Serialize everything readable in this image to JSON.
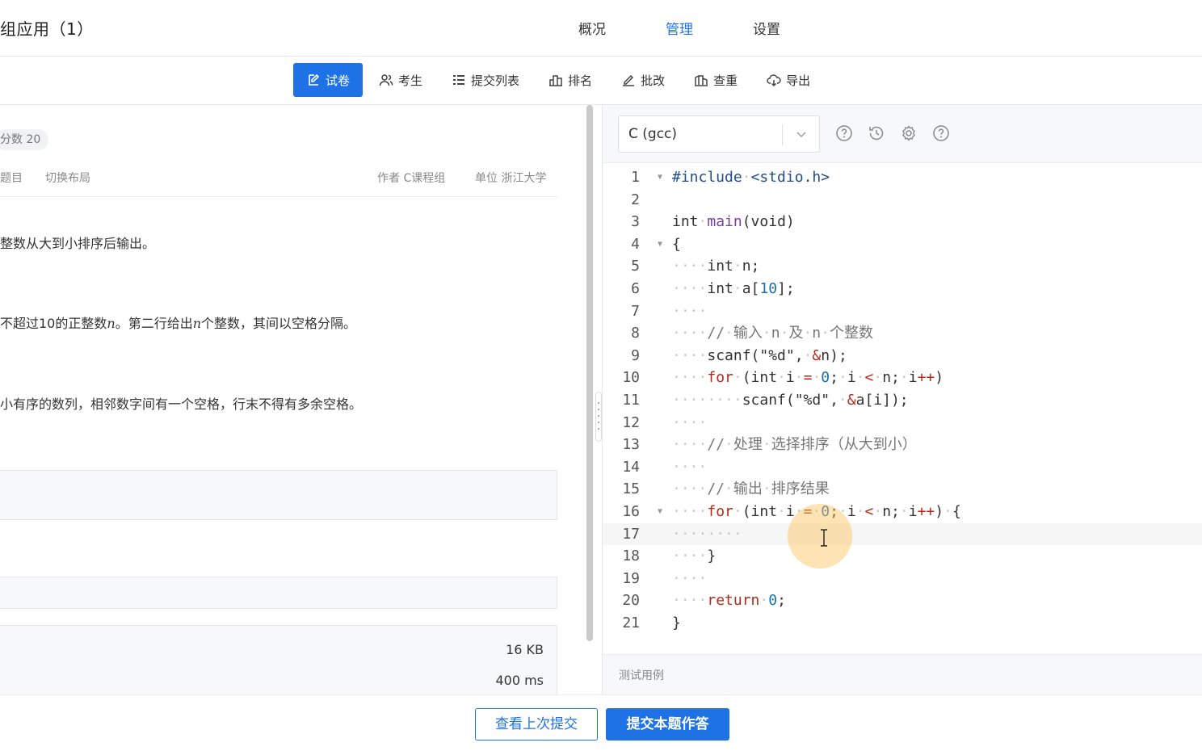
{
  "header": {
    "title": "组应用（1）",
    "nav": [
      {
        "label": "概况",
        "active": false
      },
      {
        "label": "管理",
        "active": true
      },
      {
        "label": "设置",
        "active": false
      }
    ]
  },
  "tabs": [
    {
      "label": "试卷",
      "icon": "edit-icon",
      "active": true
    },
    {
      "label": "考生",
      "icon": "users-icon",
      "active": false
    },
    {
      "label": "提交列表",
      "icon": "list-icon",
      "active": false
    },
    {
      "label": "排名",
      "icon": "ranking-icon",
      "active": false
    },
    {
      "label": "批改",
      "icon": "pen-icon",
      "active": false
    },
    {
      "label": "查重",
      "icon": "duplicate-check-icon",
      "active": false
    },
    {
      "label": "导出",
      "icon": "cloud-download-icon",
      "active": false
    }
  ],
  "problem": {
    "score": "分数 20",
    "links": [
      "题目",
      "切换布局"
    ],
    "author": "作者 C课程组",
    "unit": "单位 浙江大学",
    "desc1": "整数从大到小排序后输出。",
    "input_desc_a": "不超过10的正整数",
    "input_var1": "n",
    "input_desc_b": "。第二行给出",
    "input_var2": "n",
    "input_desc_c": "个整数，其间以空格分隔。",
    "output_desc": "小有序的数列，相邻数字间有一个空格，行末不得有多余空格。",
    "memory_limit": "16 KB",
    "time_limit": "400 ms"
  },
  "editor": {
    "language": "C (gcc)",
    "current_line": 17,
    "lines": [
      [
        [
          "pp",
          "#include"
        ],
        [
          "ws",
          "·"
        ],
        [
          "pp",
          "<stdio.h>"
        ]
      ],
      [],
      [
        [
          "",
          "int"
        ],
        [
          "ws",
          "·"
        ],
        [
          "fn",
          "main"
        ],
        [
          "",
          "(void)"
        ]
      ],
      [
        [
          "",
          "{"
        ]
      ],
      [
        [
          "ws",
          "····"
        ],
        [
          "",
          "int"
        ],
        [
          "ws",
          "·"
        ],
        [
          "",
          "n;"
        ]
      ],
      [
        [
          "ws",
          "····"
        ],
        [
          "",
          "int"
        ],
        [
          "ws",
          "·"
        ],
        [
          "",
          "a["
        ],
        [
          "num",
          "10"
        ],
        [
          "",
          "];"
        ]
      ],
      [
        [
          "ws",
          "····"
        ]
      ],
      [
        [
          "ws",
          "····"
        ],
        [
          "cm",
          "//"
        ],
        [
          "ws",
          "·"
        ],
        [
          "cm",
          "输入"
        ],
        [
          "ws",
          "·"
        ],
        [
          "cm",
          "n"
        ],
        [
          "ws",
          "·"
        ],
        [
          "cm",
          "及"
        ],
        [
          "ws",
          "·"
        ],
        [
          "cm",
          "n"
        ],
        [
          "ws",
          "·"
        ],
        [
          "cm",
          "个整数"
        ]
      ],
      [
        [
          "ws",
          "····"
        ],
        [
          "",
          "scanf(\"%d\","
        ],
        [
          "ws",
          "·"
        ],
        [
          "op",
          "&"
        ],
        [
          "",
          "n);"
        ]
      ],
      [
        [
          "ws",
          "····"
        ],
        [
          "kw",
          "for"
        ],
        [
          "ws",
          "·"
        ],
        [
          "",
          "(int"
        ],
        [
          "ws",
          "·"
        ],
        [
          "",
          "i"
        ],
        [
          "ws",
          "·"
        ],
        [
          "op",
          "="
        ],
        [
          "ws",
          "·"
        ],
        [
          "num",
          "0"
        ],
        [
          "",
          ";"
        ],
        [
          "ws",
          "·"
        ],
        [
          "",
          "i"
        ],
        [
          "ws",
          "·"
        ],
        [
          "op",
          "<"
        ],
        [
          "ws",
          "·"
        ],
        [
          "",
          "n;"
        ],
        [
          "ws",
          "·"
        ],
        [
          "",
          "i"
        ],
        [
          "op",
          "++"
        ],
        [
          "",
          ")"
        ]
      ],
      [
        [
          "ws",
          "········"
        ],
        [
          "",
          "scanf(\"%d\","
        ],
        [
          "ws",
          "·"
        ],
        [
          "op",
          "&"
        ],
        [
          "",
          "a[i]);"
        ]
      ],
      [
        [
          "ws",
          "····"
        ]
      ],
      [
        [
          "ws",
          "····"
        ],
        [
          "cm",
          "//"
        ],
        [
          "ws",
          "·"
        ],
        [
          "cm",
          "处理"
        ],
        [
          "ws",
          "·"
        ],
        [
          "cm",
          "选择排序（从大到小）"
        ]
      ],
      [
        [
          "ws",
          "····"
        ]
      ],
      [
        [
          "ws",
          "····"
        ],
        [
          "cm",
          "//"
        ],
        [
          "ws",
          "·"
        ],
        [
          "cm",
          "输出"
        ],
        [
          "ws",
          "·"
        ],
        [
          "cm",
          "排序结果"
        ]
      ],
      [
        [
          "ws",
          "····"
        ],
        [
          "kw",
          "for"
        ],
        [
          "ws",
          "·"
        ],
        [
          "",
          "(int"
        ],
        [
          "ws",
          "·"
        ],
        [
          "",
          "i"
        ],
        [
          "ws",
          "·"
        ],
        [
          "op",
          "="
        ],
        [
          "ws",
          "·"
        ],
        [
          "num",
          "0"
        ],
        [
          "",
          ";"
        ],
        [
          "ws",
          "·"
        ],
        [
          "",
          "i"
        ],
        [
          "ws",
          "·"
        ],
        [
          "op",
          "<"
        ],
        [
          "ws",
          "·"
        ],
        [
          "",
          "n;"
        ],
        [
          "ws",
          "·"
        ],
        [
          "",
          "i"
        ],
        [
          "op",
          "++"
        ],
        [
          "",
          ")"
        ],
        [
          "ws",
          "·"
        ],
        [
          "",
          "{"
        ]
      ],
      [
        [
          "ws",
          "········"
        ]
      ],
      [
        [
          "ws",
          "····"
        ],
        [
          "",
          "}"
        ]
      ],
      [
        [
          "ws",
          "····"
        ]
      ],
      [
        [
          "ws",
          "····"
        ],
        [
          "kw",
          "return"
        ],
        [
          "ws",
          "·"
        ],
        [
          "num",
          "0"
        ],
        [
          "",
          ";"
        ]
      ],
      [
        [
          "",
          "}"
        ]
      ]
    ],
    "fold_lines": [
      1,
      4,
      16
    ],
    "testcase_label": "测试用例"
  },
  "footer": {
    "view_last": "查看上次提交",
    "submit": "提交本题作答"
  },
  "colors": {
    "accent": "#1f72e6"
  }
}
